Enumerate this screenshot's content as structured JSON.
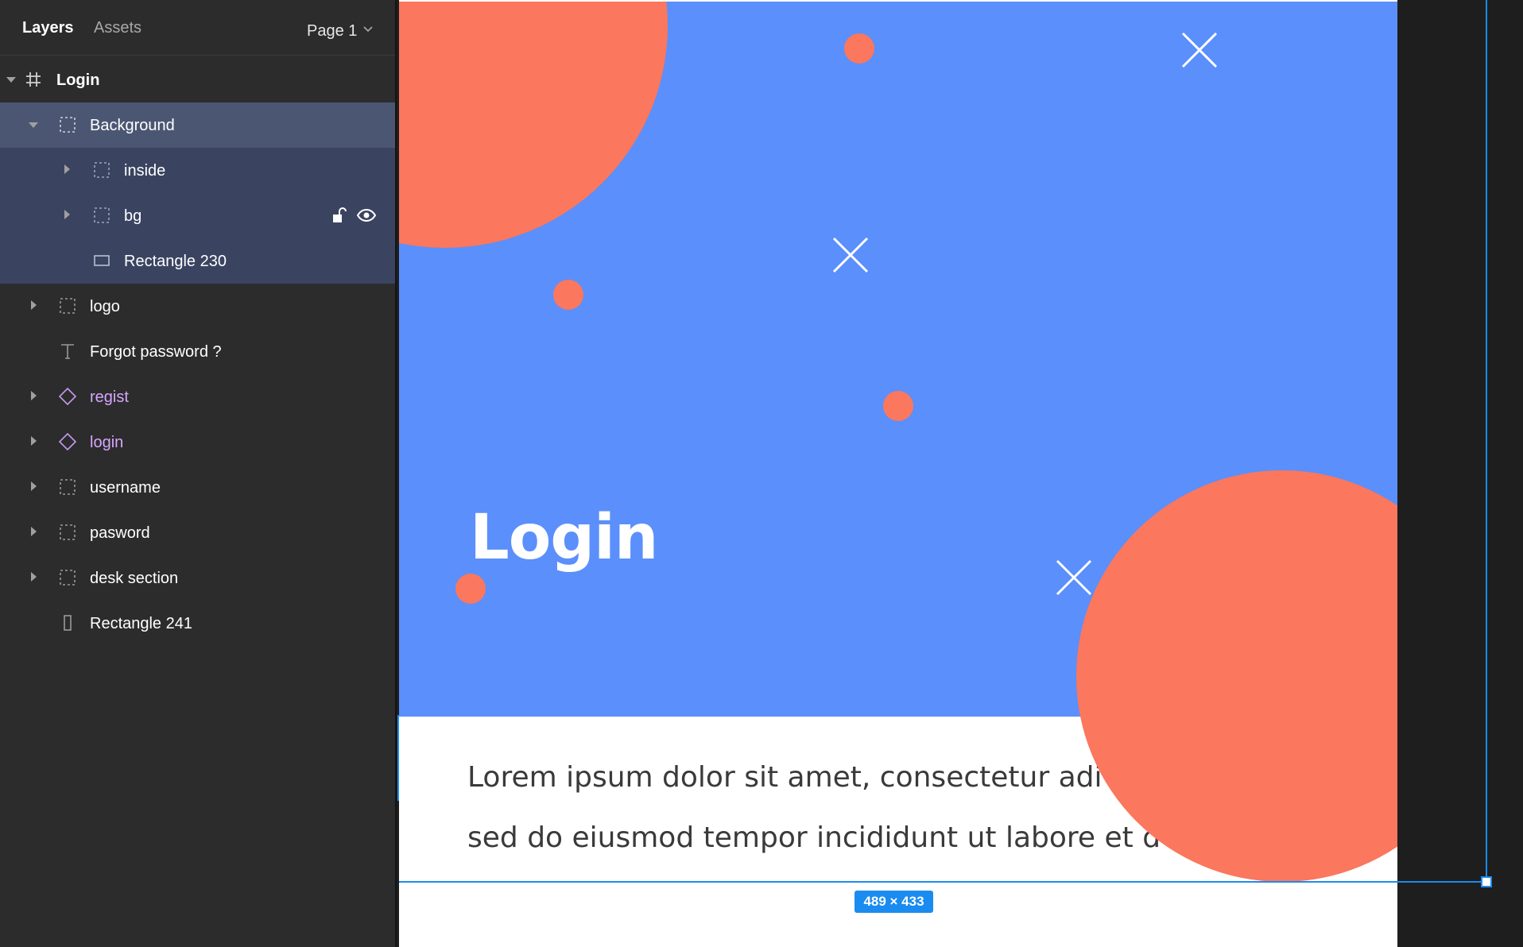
{
  "panel": {
    "tabs": {
      "layers": "Layers",
      "assets": "Assets"
    },
    "page": {
      "label": "Page 1"
    }
  },
  "layers": [
    {
      "label": "Login",
      "type": "frame",
      "expanded": true
    },
    {
      "label": "Background",
      "type": "group",
      "expanded": true,
      "selected": true
    },
    {
      "label": "inside",
      "type": "group"
    },
    {
      "label": "bg",
      "type": "group"
    },
    {
      "label": "Rectangle 230",
      "type": "rectangle"
    },
    {
      "label": "logo",
      "type": "group"
    },
    {
      "label": "Forgot password ?",
      "type": "text"
    },
    {
      "label": "regist",
      "type": "component"
    },
    {
      "label": "login",
      "type": "component"
    },
    {
      "label": "username",
      "type": "group"
    },
    {
      "label": "pasword",
      "type": "group"
    },
    {
      "label": "desk section",
      "type": "group"
    },
    {
      "label": "Rectangle 241",
      "type": "rectangle"
    }
  ],
  "canvas": {
    "heading": "Login",
    "lorem_line_1": "Lorem ipsum dolor sit amet, consectetur adi",
    "lorem_line_2": "sed do eiusmod tempor incididunt ut labore et d",
    "selection_size": "489 × 433"
  },
  "colors": {
    "blue": "#5b8ffb",
    "coral": "#fb775d",
    "selection": "#1a8cf0",
    "component": "#d6a6ff"
  }
}
